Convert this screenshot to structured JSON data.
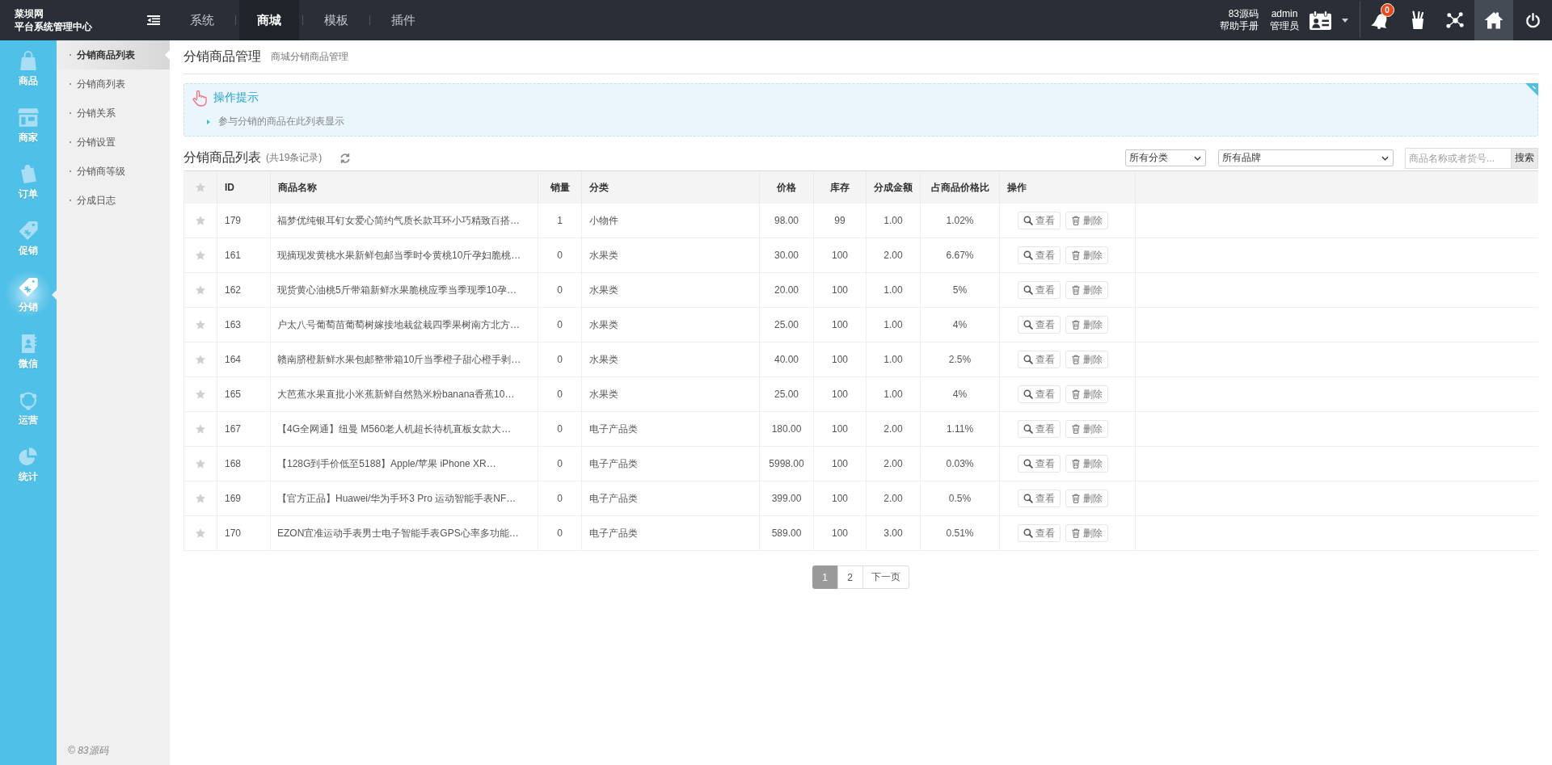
{
  "topbar": {
    "logo": [
      "菜坝网",
      "平台系统管理中心"
    ],
    "nav": [
      {
        "label": "系统",
        "selected": false
      },
      {
        "label": "商城",
        "selected": true
      },
      {
        "label": "模板",
        "selected": false
      },
      {
        "label": "插件",
        "selected": false
      }
    ],
    "help": [
      "83源码",
      "帮助手册"
    ],
    "user": [
      "admin",
      "管理员"
    ],
    "notification_count": "0"
  },
  "sidebar": {
    "items": [
      {
        "label": "商品",
        "selected": false
      },
      {
        "label": "商家",
        "selected": false
      },
      {
        "label": "订单",
        "selected": false
      },
      {
        "label": "促销",
        "selected": false
      },
      {
        "label": "分销",
        "selected": true
      },
      {
        "label": "微信",
        "selected": false
      },
      {
        "label": "运营",
        "selected": false
      },
      {
        "label": "统计",
        "selected": false
      }
    ]
  },
  "subnav": {
    "items": [
      {
        "label": "分销商品列表",
        "selected": true
      },
      {
        "label": "分销商列表",
        "selected": false
      },
      {
        "label": "分销关系",
        "selected": false
      },
      {
        "label": "分销设置",
        "selected": false
      },
      {
        "label": "分销商等级",
        "selected": false
      },
      {
        "label": "分成日志",
        "selected": false
      }
    ],
    "footer": "© 83源码"
  },
  "page_header": {
    "title": "分销商品管理",
    "subtitle": "商城分销商品管理"
  },
  "tips": {
    "title": "操作提示",
    "items": [
      "参与分销的商品在此列表显示"
    ]
  },
  "list_bar": {
    "title": "分销商品列表",
    "count": "(共19条记录)",
    "filters": [
      {
        "value": "所有分类"
      },
      {
        "value": "所有品牌"
      }
    ],
    "search": {
      "placeholder": "商品名称或者货号...",
      "button": "搜索"
    }
  },
  "table": {
    "columns": [
      "ID",
      "商品名称",
      "销量",
      "分类",
      "价格",
      "库存",
      "分成金额",
      "占商品价格比",
      "操作"
    ],
    "rows": [
      {
        "cells": [
          "179",
          "福梦优纯银耳钉女爱心简约气质长款耳环小巧精致百搭…",
          "1",
          "小物件",
          "98.00",
          "99",
          "1.00",
          "1.02%"
        ],
        "actions": [
          "查看",
          "删除"
        ]
      },
      {
        "cells": [
          "161",
          "现摘现发黄桃水果新鲜包邮当季时令黄桃10斤孕妇脆桃…",
          "0",
          "水果类",
          "30.00",
          "100",
          "2.00",
          "6.67%"
        ],
        "actions": [
          "查看",
          "删除"
        ]
      },
      {
        "cells": [
          "162",
          "现货黄心油桃5斤带箱新鲜水果脆桃应季当季现季10孕…",
          "0",
          "水果类",
          "20.00",
          "100",
          "1.00",
          "5%"
        ],
        "actions": [
          "查看",
          "删除"
        ]
      },
      {
        "cells": [
          "163",
          "户太八号葡萄苗葡萄树嫁接地栽盆栽四季果树南方北方…",
          "0",
          "水果类",
          "25.00",
          "100",
          "1.00",
          "4%"
        ],
        "actions": [
          "查看",
          "删除"
        ]
      },
      {
        "cells": [
          "164",
          "赣南脐橙新鲜水果包邮整带箱10斤当季橙子甜心橙手剥…",
          "0",
          "水果类",
          "40.00",
          "100",
          "1.00",
          "2.5%"
        ],
        "actions": [
          "查看",
          "删除"
        ]
      },
      {
        "cells": [
          "165",
          "大芭蕉水果直批小米蕉新鲜自然熟米粉banana香蕉10…",
          "0",
          "水果类",
          "25.00",
          "100",
          "1.00",
          "4%"
        ],
        "actions": [
          "查看",
          "删除"
        ]
      },
      {
        "cells": [
          "167",
          "【4G全网通】纽曼 M560老人机超长待机直板女款大…",
          "0",
          "电子产品类",
          "180.00",
          "100",
          "2.00",
          "1.11%"
        ],
        "actions": [
          "查看",
          "删除"
        ]
      },
      {
        "cells": [
          "168",
          "【128G到手价低至5188】Apple/苹果 iPhone XR…",
          "0",
          "电子产品类",
          "5998.00",
          "100",
          "2.00",
          "0.03%"
        ],
        "actions": [
          "查看",
          "删除"
        ]
      },
      {
        "cells": [
          "169",
          "【官方正品】Huawei/华为手环3 Pro 运动智能手表NF…",
          "0",
          "电子产品类",
          "399.00",
          "100",
          "2.00",
          "0.5%"
        ],
        "actions": [
          "查看",
          "删除"
        ]
      },
      {
        "cells": [
          "170",
          "EZON宜准运动手表男士电子智能手表GPS心率多功能…",
          "0",
          "电子产品类",
          "589.00",
          "100",
          "3.00",
          "0.51%"
        ],
        "actions": [
          "查看",
          "删除"
        ]
      }
    ]
  },
  "pagination": {
    "pages": [
      {
        "label": "1",
        "selected": true
      },
      {
        "label": "2",
        "selected": false
      }
    ],
    "next": "下一页"
  }
}
